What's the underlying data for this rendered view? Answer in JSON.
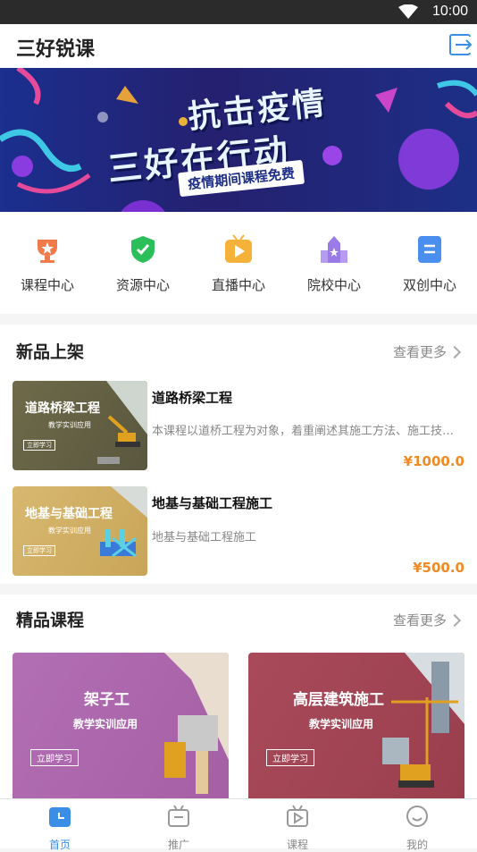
{
  "status": {
    "time": "10:00"
  },
  "app": {
    "title": "三好锐课"
  },
  "banner": {
    "line1": "抗击疫情",
    "line2": "三好在行动",
    "tag": "疫情期间课程免费"
  },
  "categories": [
    {
      "label": "课程中心",
      "icon": "trophy-icon"
    },
    {
      "label": "资源中心",
      "icon": "shield-check-icon"
    },
    {
      "label": "直播中心",
      "icon": "tv-play-icon"
    },
    {
      "label": "院校中心",
      "icon": "school-icon"
    },
    {
      "label": "双创中心",
      "icon": "document-icon"
    }
  ],
  "new_products": {
    "title": "新品上架",
    "more": "查看更多",
    "items": [
      {
        "thumb_title": "道路桥梁工程",
        "thumb_sub": "教学实训应用",
        "thumb_btn": "立即学习",
        "name": "道路桥梁工程",
        "desc": "本课程以道桥工程为对象，着重阐述其施工方法、施工技术、…",
        "price": "¥1000.0"
      },
      {
        "thumb_title": "地基与基础工程",
        "thumb_sub": "教学实训应用",
        "thumb_btn": "立即学习",
        "name": "地基与基础工程施工",
        "desc": "地基与基础工程施工",
        "price": "¥500.0"
      }
    ]
  },
  "premium": {
    "title": "精品课程",
    "more": "查看更多",
    "cards": [
      {
        "title": "架子工",
        "sub": "教学实训应用",
        "btn": "立即学习"
      },
      {
        "title": "高层建筑施工",
        "sub": "教学实训应用",
        "btn": "立即学习"
      }
    ]
  },
  "tabs": [
    {
      "label": "首页",
      "icon": "home-icon",
      "active": true
    },
    {
      "label": "推广",
      "icon": "promote-icon",
      "active": false
    },
    {
      "label": "课程",
      "icon": "play-icon",
      "active": false
    },
    {
      "label": "我的",
      "icon": "smile-icon",
      "active": false
    }
  ],
  "colors": {
    "accent": "#3a8ee6",
    "price": "#f08a24"
  }
}
